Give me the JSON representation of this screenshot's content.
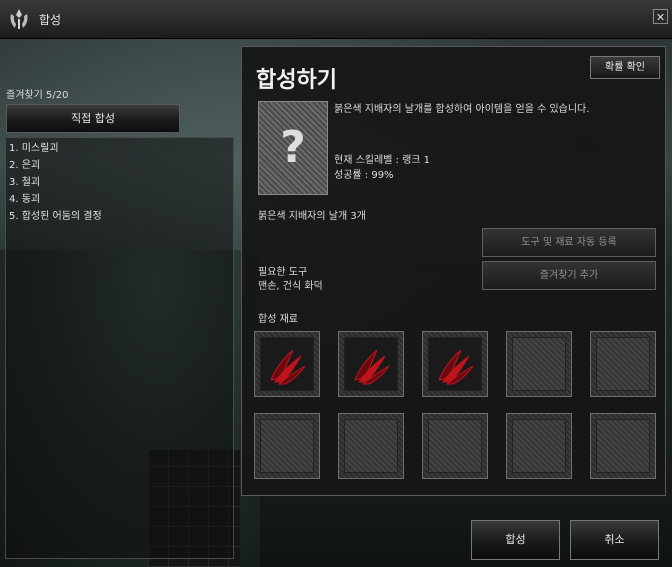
{
  "window": {
    "title": "합성",
    "close": "✕"
  },
  "left": {
    "favorites_count": "즐겨찾기 5/20",
    "direct_button": "직접 합성",
    "recipes": [
      "1. 미스릴괴",
      "2. 은괴",
      "3. 철괴",
      "4. 동괴",
      "5. 합성된 어둠의 결정"
    ]
  },
  "panel": {
    "title": "합성하기",
    "confirm_button": "확률 확인",
    "unknown_mark": "?",
    "description": "붉은색 지배자의 날개를 합성하여 아이템을 얻을 수 있습니다.",
    "skill_level": "현재 스킬레벨 : 랭크 1",
    "success_rate": "성공률 : 99%",
    "result_item": "붉은색 지배자의 날개 3개",
    "auto_register_button": "도구 및 재료 자동 등록",
    "add_favorite_button": "즐겨찾기 추가",
    "tools_label": "필요한 도구",
    "tools_value": "맨손, 건식 화덕",
    "materials_label": "합성 재료",
    "materials": [
      "red-wing",
      "red-wing",
      "red-wing",
      "empty",
      "empty",
      "empty",
      "empty",
      "empty",
      "empty",
      "empty"
    ]
  },
  "footer": {
    "synthesize_button": "합성",
    "cancel_button": "취소"
  },
  "colors": {
    "wing_red": "#c0141c",
    "wing_dark": "#6a0a0e"
  }
}
